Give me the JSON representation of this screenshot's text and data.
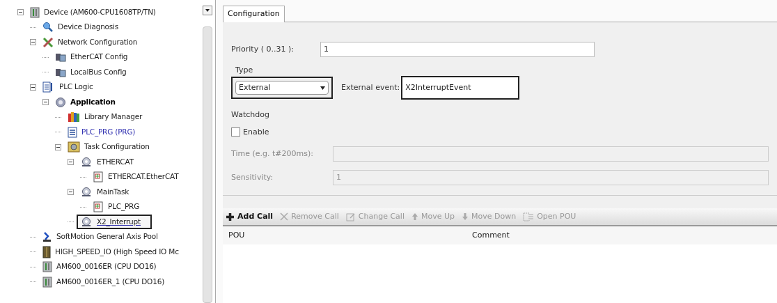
{
  "tree": [
    {
      "label": "Device (AM600-CPU1608TP/TN)",
      "kind": "device",
      "expanded": true,
      "highlighted": false,
      "children": [
        {
          "label": "Device Diagnosis",
          "kind": "diagnosis",
          "highlighted": false
        },
        {
          "label": "Network Configuration",
          "kind": "network",
          "expanded": true,
          "highlighted": false,
          "children": [
            {
              "label": "EtherCAT Config",
              "kind": "bus",
              "highlighted": false
            },
            {
              "label": "LocalBus Config",
              "kind": "bus",
              "highlighted": false
            }
          ]
        },
        {
          "label": "PLC Logic",
          "kind": "logic",
          "expanded": true,
          "highlighted": false,
          "children": [
            {
              "label": "Application",
              "kind": "application",
              "expanded": true,
              "highlighted": false,
              "children": [
                {
                  "label": "Library Manager",
                  "kind": "library",
                  "highlighted": false
                },
                {
                  "label": "PLC_PRG (PRG)",
                  "kind": "program",
                  "highlighted": false
                },
                {
                  "label": "Task Configuration",
                  "kind": "taskconfig",
                  "expanded": true,
                  "highlighted": false,
                  "children": [
                    {
                      "label": "ETHERCAT",
                      "kind": "task",
                      "expanded": true,
                      "highlighted": false,
                      "children": [
                        {
                          "label": "ETHERCAT.EtherCAT",
                          "kind": "call",
                          "highlighted": false
                        }
                      ]
                    },
                    {
                      "label": "MainTask",
                      "kind": "task",
                      "expanded": true,
                      "highlighted": false,
                      "children": [
                        {
                          "label": "PLC_PRG",
                          "kind": "call",
                          "highlighted": false
                        }
                      ]
                    },
                    {
                      "label": "X2_Interrupt",
                      "kind": "task",
                      "highlighted": true
                    }
                  ]
                }
              ]
            }
          ]
        },
        {
          "label": "SoftMotion General Axis Pool",
          "kind": "axis",
          "highlighted": false
        },
        {
          "label": "HIGH_SPEED_IO (High Speed IO Mc",
          "kind": "io",
          "highlighted": false
        },
        {
          "label": "AM600_0016ER (CPU DO16)",
          "kind": "device",
          "highlighted": false
        },
        {
          "label": "AM600_0016ER_1 (CPU DO16)",
          "kind": "device",
          "highlighted": false
        }
      ]
    }
  ],
  "tabs": [
    {
      "label": "Configuration",
      "selected": true
    }
  ],
  "priority": {
    "label": "Priority ( 0..31 ):",
    "value": "1"
  },
  "type": {
    "label": "Type",
    "value": "External",
    "highlighted": true
  },
  "external_event": {
    "label": "External event:",
    "value": "X2InterruptEvent",
    "highlighted": true
  },
  "watchdog": {
    "label": "Watchdog",
    "enable_label": "Enable",
    "checked": false,
    "time_label": "Time (e.g. t#200ms):",
    "sensitivity_label": "Sensitivity:",
    "sensitivity_value": "1"
  },
  "toolbar": [
    {
      "label": "Add Call",
      "kind": "add",
      "disabled": false
    },
    {
      "label": "Remove Call",
      "kind": "remove",
      "disabled": true
    },
    {
      "label": "Change Call",
      "kind": "edit",
      "disabled": true
    },
    {
      "label": "Move Up",
      "kind": "up",
      "disabled": true
    },
    {
      "label": "Move Down",
      "kind": "down",
      "disabled": true
    },
    {
      "label": "Open POU",
      "kind": "open",
      "disabled": true
    }
  ],
  "table": {
    "columns": [
      "POU",
      "Comment"
    ]
  }
}
